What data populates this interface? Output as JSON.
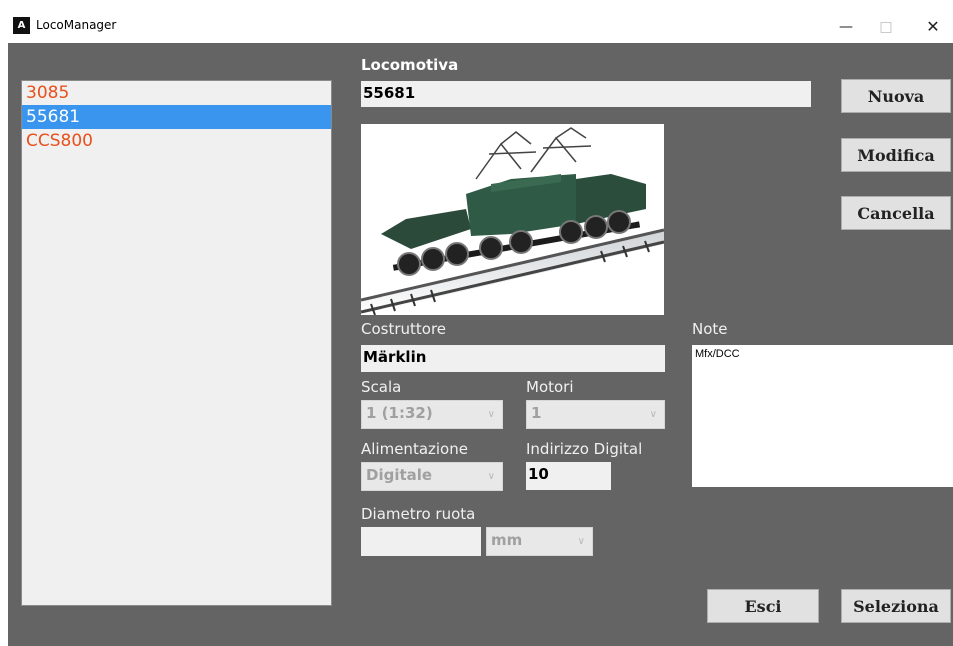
{
  "window": {
    "title": "LocoManager",
    "icon": "app-logo-icon"
  },
  "list": {
    "items": [
      "3085",
      "55681",
      "CCS800"
    ],
    "selected": "55681"
  },
  "form": {
    "locomotiva_label": "Locomotiva",
    "locomotiva_value": "55681",
    "costruttore_label": "Costruttore",
    "costruttore_value": "Märklin",
    "scala_label": "Scala",
    "scala_value": "1 (1:32)",
    "motori_label": "Motori",
    "motori_value": "1",
    "alimentazione_label": "Alimentazione",
    "alimentazione_value": "Digitale",
    "indirizzo_label": "Indirizzo Digital",
    "indirizzo_value": "10",
    "diametro_label": "Diametro ruota",
    "diametro_value": "",
    "diametro_unit": "mm",
    "note_label": "Note",
    "note_value": "Mfx/DCC"
  },
  "buttons": {
    "nuova": "Nuova",
    "modifica": "Modifica",
    "cancella": "Cancella",
    "esci": "Esci",
    "seleziona": "Seleziona"
  },
  "colors": {
    "background": "#646464",
    "list_text": "#e8501c",
    "selection": "#3a95ef"
  }
}
